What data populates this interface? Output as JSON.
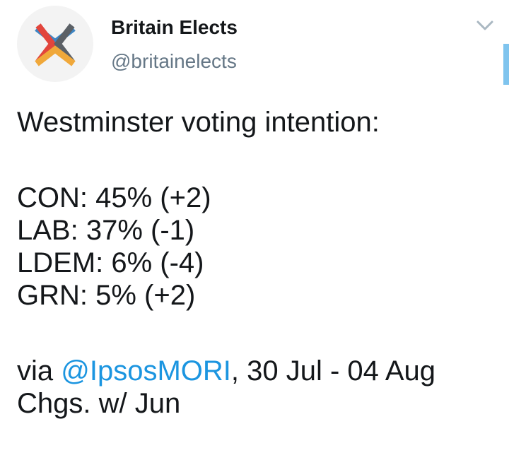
{
  "author": {
    "display_name": "Britain Elects",
    "handle": "@britainelects"
  },
  "tweet": {
    "heading": "Westminster voting intention:",
    "results": [
      "CON: 45% (+2)",
      "LAB: 37% (-1)",
      "LDEM: 6% (-4)",
      "GRN: 5% (+2)"
    ],
    "source_prefix": "via ",
    "source_mention": "@IpsosMORI",
    "source_suffix": ", 30 Jul - 04 Aug",
    "changes_note": "Chgs. w/ Jun"
  },
  "icons": {
    "avatar": "britain-elects-logo",
    "menu": "chevron-down-icon"
  },
  "colors": {
    "text": "#14171a",
    "secondary_text": "#657786",
    "link": "#1b95e0",
    "logo_blue": "#3e86c4",
    "logo_red": "#e2453c",
    "logo_orange": "#f0a83a",
    "logo_grey": "#5b6066"
  }
}
